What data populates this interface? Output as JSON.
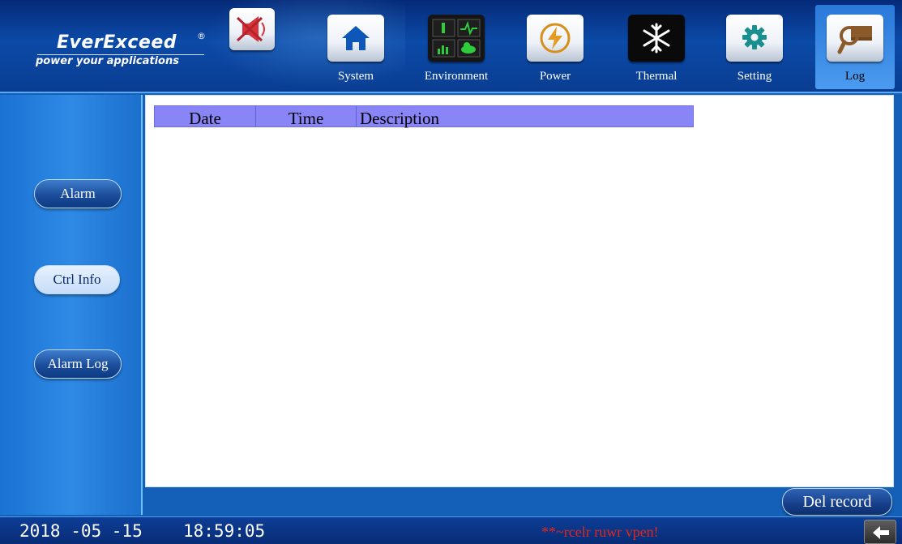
{
  "brand": {
    "name": "EverExceed",
    "registered_mark": "®",
    "tagline": "power your applications"
  },
  "nav": {
    "mute_icon": "speaker-mute-icon",
    "items": [
      {
        "label": "System",
        "icon": "home-icon"
      },
      {
        "label": "Environment",
        "icon": "environment-icon"
      },
      {
        "label": "Power",
        "icon": "lightning-icon"
      },
      {
        "label": "Thermal",
        "icon": "snowflake-icon"
      },
      {
        "label": "Setting",
        "icon": "gear-icon"
      },
      {
        "label": "Log",
        "icon": "log-icon",
        "active": true
      }
    ]
  },
  "sidebar": {
    "items": [
      {
        "label": "Alarm",
        "active": false
      },
      {
        "label": "Ctrl Info",
        "active": true
      },
      {
        "label": "Alarm Log",
        "active": false
      }
    ]
  },
  "table": {
    "columns": [
      "Date",
      "Time",
      "Description"
    ],
    "rows": []
  },
  "actions": {
    "del_record": "Del record"
  },
  "status": {
    "date": "2018 -05 -15",
    "time": "18:59:05",
    "alert": "**~rcelr ruwr vpen!"
  },
  "colors": {
    "header_bg": "#0b4aa8",
    "panel_bg": "#1a72d2",
    "table_header": "#8a85f6",
    "alert": "#e3261b"
  }
}
